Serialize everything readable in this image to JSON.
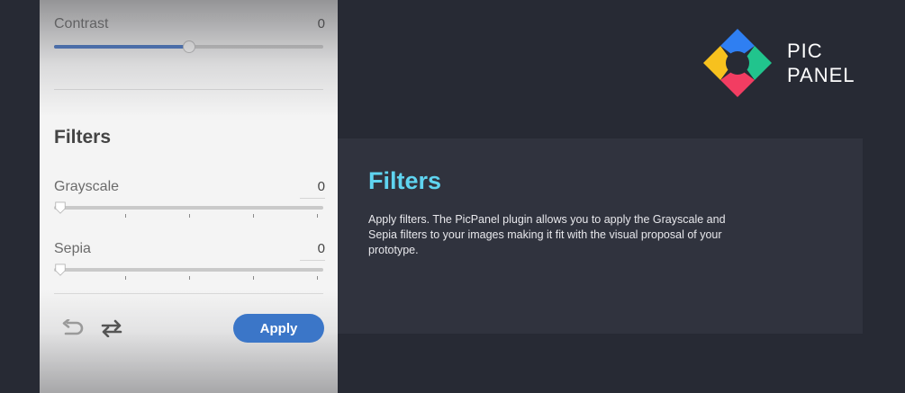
{
  "panel": {
    "contrast": {
      "label": "Contrast",
      "value": "0",
      "level": 0.5
    },
    "filters_title": "Filters",
    "grayscale": {
      "label": "Grayscale",
      "value": "0",
      "level": 0
    },
    "sepia": {
      "label": "Sepia",
      "value": "0",
      "level": 0
    },
    "apply_label": "Apply"
  },
  "logo": {
    "line1": "PIC",
    "line2": "PANEL"
  },
  "info": {
    "title": "Filters",
    "description": "Apply filters. The PicPanel plugin allows you to apply the Grayscale and Sepia filters to your images making it fit with the visual proposal of your prototype."
  },
  "colors": {
    "background": "#272a34",
    "card": "#30333e",
    "accent_title": "#5fd4f0",
    "apply_button": "#3b76c8",
    "slider_fill": "#3b6fc4"
  }
}
